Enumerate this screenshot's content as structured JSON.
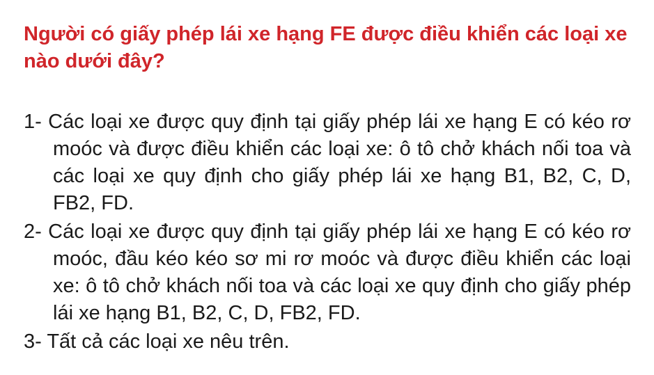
{
  "question": {
    "text": "Người có giấy phép lái xe hạng FE được điều khiển các loại xe nào dưới đây?",
    "color": "#d0252a"
  },
  "answers": [
    {
      "text": "1- Các loại xe được quy định tại giấy phép lái xe hạng E có kéo rơ moóc và được điều khiển các loại xe: ô tô chở khách nối toa và các loại xe quy định cho giấy phép lái xe hạng B1, B2, C, D, FB2, FD."
    },
    {
      "text": "2- Các loại xe được quy định tại giấy phép lái xe hạng E có kéo rơ moóc, đầu kéo kéo sơ mi rơ moóc và được điều khiển các loại xe: ô tô chở khách nối toa và các loại xe quy định cho giấy phép lái xe hạng B1, B2, C, D, FB2, FD."
    },
    {
      "text": "3- Tất cả các loại xe nêu trên."
    }
  ]
}
